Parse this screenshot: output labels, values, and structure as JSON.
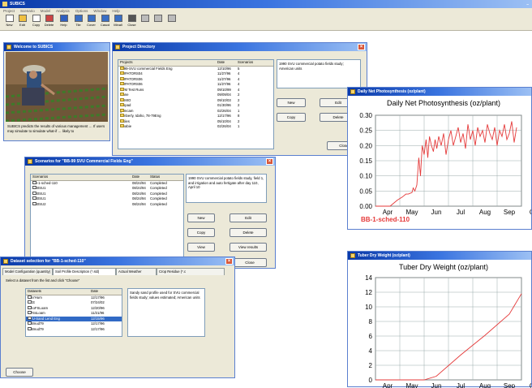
{
  "app": {
    "title": "SUBICS",
    "menu": [
      "Project",
      "Scenario",
      "Model",
      "Analysis",
      "Options",
      "Window",
      "Help"
    ],
    "toolbar": [
      {
        "label": "New",
        "icon": "new-file-icon"
      },
      {
        "label": "Edit",
        "icon": "edit-icon"
      },
      {
        "label": "Copy",
        "icon": "copy-icon"
      },
      {
        "label": "Delete",
        "icon": "delete-icon"
      },
      {
        "label": "Help",
        "icon": "help-icon"
      },
      {
        "label": "Tile",
        "icon": "tile-icon"
      },
      {
        "label": "Cover",
        "icon": "cover-icon"
      },
      {
        "label": "Cascd",
        "icon": "cascade-icon"
      },
      {
        "label": "Minall",
        "icon": "minimize-all-icon"
      },
      {
        "label": "Close",
        "icon": "close-all-icon"
      },
      {
        "label": "",
        "icon": "arrow-icon"
      },
      {
        "label": "",
        "icon": "arrow-icon"
      },
      {
        "label": "",
        "icon": "grid-icon"
      }
    ]
  },
  "welcome": {
    "title": "Welcome to SUBICS",
    "text": "SUBICS predicts the results of various management … If users may simulate to simulate what-if … likely to"
  },
  "project": {
    "title": "Project Directory",
    "headers": [
      "Projects",
      "Date",
      "Scenarios"
    ],
    "rows": [
      [
        "1999-SVU commercial Fields Eng",
        "12/10/96",
        "5"
      ],
      [
        "SUPATORS04",
        "11/27/96",
        "4"
      ],
      [
        "SUPATORS06",
        "11/27/96",
        "4"
      ],
      [
        "SUPATORS06",
        "11/27/96",
        "4"
      ],
      [
        "ZPM Test Runs",
        "09/10/99",
        "4"
      ],
      [
        "blane",
        "09/09/04",
        "2"
      ],
      [
        "FAMIO",
        "09/10/03",
        "2"
      ],
      [
        "Sibpad",
        "01/30/96",
        "2"
      ],
      [
        "gemcam",
        "02/26/04",
        "1"
      ],
      [
        "Kimberly, Idaho, 78-79Eng",
        "12/17/96",
        "8"
      ],
      [
        "leslies",
        "05/10/04",
        "2"
      ],
      [
        "Swabie",
        "02/26/04",
        "1"
      ]
    ],
    "description": "1990 SVU commercial potato fields study; American units",
    "buttons": {
      "new": "New",
      "edit": "Edit",
      "copy": "Copy",
      "delete": "Delete",
      "close": "Close"
    }
  },
  "scenarios": {
    "title": "Scenarios for \"BB-99 SVU Commercial Fields Eng\"",
    "headers": [
      "Scenarios",
      "Date",
      "Status"
    ],
    "rows": [
      [
        "BB-1-sched-110",
        "08/24/94",
        "Completed"
      ],
      [
        "BB0SU1",
        "08/24/94",
        "Completed"
      ],
      [
        "BB0SU1",
        "08/24/94",
        "Completed"
      ],
      [
        "BB0SU1",
        "08/24/94",
        "Completed"
      ],
      [
        "BB0SU2",
        "08/24/94",
        "Completed"
      ]
    ],
    "description": "1990 SVU commercial potato fields study, field 1, and irrigation and auto fertigate after day 110, April 10",
    "buttons": {
      "new": "New",
      "edit": "Edit",
      "copy": "Copy",
      "delete": "Delete",
      "view": "View",
      "results": "View results",
      "close": "Close"
    }
  },
  "dataset": {
    "title": "Dataset selection for \"BB-1-sched-110\"",
    "tabs": [
      "Model Configuration (quantity)",
      "Soil Profile Description (*.sld)",
      "Actual Weather",
      "Crop Residue (*.c"
    ],
    "instruction": "Select a dataset from the list and click \"Choose\"",
    "headers": [
      "Datasets",
      "Date"
    ],
    "rows": [
      [
        "Dan'Hum",
        "12/17/96"
      ],
      [
        "DCE",
        "07/24/02"
      ],
      [
        "HinoFSLoam",
        "12/20/96"
      ],
      [
        "HPSsLoam",
        "11/21/96"
      ],
      [
        "SVU-Sand Lend Eng",
        "12/15/96"
      ],
      [
        "Rutmud79",
        "12/17/96"
      ],
      [
        "Rutmud79",
        "12/17/96"
      ]
    ],
    "selected_index": 4,
    "description": "Sandy sand profile used for SVU commercial fields study; values estimated; American units",
    "choose_label": "Choose"
  },
  "photo_window": {
    "title": "Daily Net Photosynthesis (oz/plant)",
    "legend": "BB-1-sched-110"
  },
  "tuber_window": {
    "title": "Tuber Dry Weight (oz/plant)"
  },
  "colors": {
    "series": "#e53a3a",
    "titlebar": "#0a3aa8",
    "window": "#ece9d8",
    "selection": "#316ac5"
  },
  "chart_data": [
    {
      "type": "line",
      "title": "Daily Net Photosynthesis (oz/plant)",
      "x_ticks": [
        "Apr",
        "May",
        "Jun",
        "Jul",
        "Aug",
        "Sep",
        "Oc"
      ],
      "ylim": [
        0,
        0.3
      ],
      "y_ticks": [
        "0.00",
        "0.05",
        "0.10",
        "0.15",
        "0.20",
        "0.25",
        "0.30"
      ],
      "grid": true,
      "series": [
        {
          "name": "BB-1-sched-110",
          "x": [
            0,
            0.6,
            0.9,
            1.1,
            1.25,
            1.35,
            1.5,
            1.55,
            1.62,
            1.7,
            1.78,
            1.85,
            1.92,
            2.0,
            2.08,
            2.15,
            2.22,
            2.3,
            2.38,
            2.45,
            2.52,
            2.6,
            2.7,
            2.8,
            2.9,
            3.0,
            3.1,
            3.2,
            3.3,
            3.4,
            3.5,
            3.6,
            3.7,
            3.8,
            3.9,
            4.0,
            4.1,
            4.2,
            4.3,
            4.4,
            4.5,
            4.6,
            4.7,
            4.8,
            4.9,
            5.0,
            5.1,
            5.2,
            5.3,
            5.4,
            5.5,
            5.6,
            5.7,
            5.8
          ],
          "y": [
            0,
            0,
            0.02,
            0.03,
            0.04,
            0.04,
            0.045,
            0.06,
            0.05,
            0.07,
            0.16,
            0.1,
            0.2,
            0.17,
            0.22,
            0.16,
            0.23,
            0.2,
            0.18,
            0.22,
            0.19,
            0.23,
            0.2,
            0.24,
            0.17,
            0.22,
            0.25,
            0.2,
            0.23,
            0.26,
            0.21,
            0.24,
            0.19,
            0.27,
            0.22,
            0.25,
            0.2,
            0.26,
            0.23,
            0.25,
            0.21,
            0.27,
            0.24,
            0.22,
            0.26,
            0.2,
            0.25,
            0.23,
            0.27,
            0.22,
            0.24,
            0.28,
            0.21,
            0.26
          ]
        }
      ]
    },
    {
      "type": "line",
      "title": "Tuber Dry Weight (oz/plant)",
      "x_ticks": [
        "Apr",
        "May",
        "Jun",
        "Jul",
        "Aug",
        "Sep",
        "Oc"
      ],
      "ylim": [
        0,
        14
      ],
      "y_ticks": [
        "0",
        "2",
        "4",
        "6",
        "8",
        "10",
        "12",
        "14"
      ],
      "grid": true,
      "series": [
        {
          "name": "BB-1-sched-110",
          "x": [
            0,
            2.0,
            2.5,
            3.5,
            4.5,
            5.5,
            6.0
          ],
          "y": [
            0,
            0,
            0.5,
            3.4,
            6.1,
            9.0,
            11.8
          ]
        }
      ]
    }
  ]
}
